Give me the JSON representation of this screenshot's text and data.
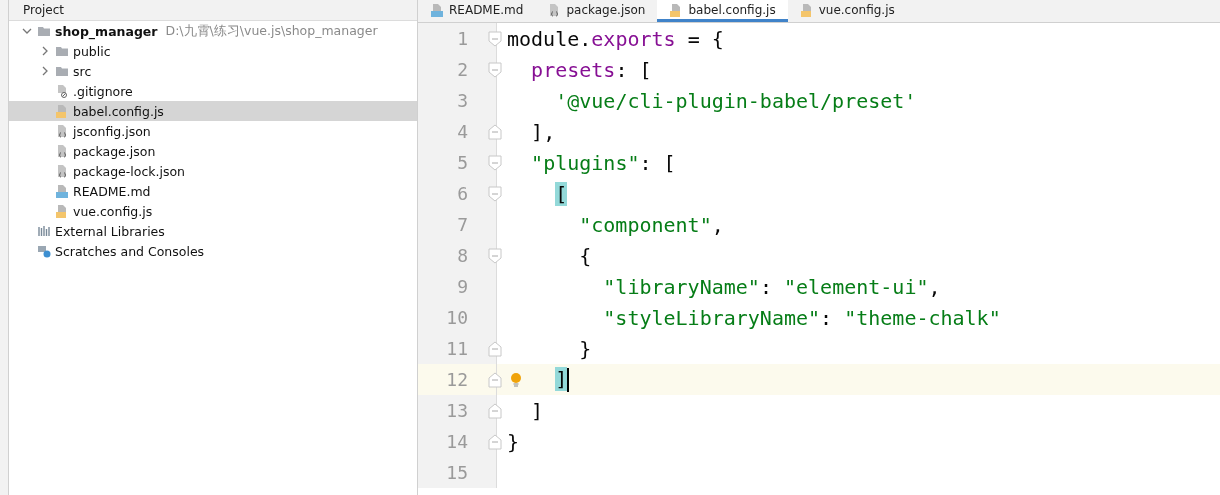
{
  "project_panel": {
    "title": "Project",
    "tree": [
      {
        "label": "shop_manager",
        "path": "D:\\九霄\\练习\\vue.js\\shop_manager",
        "kind": "folder",
        "expanded": true,
        "selected": false,
        "children": [
          {
            "label": "public",
            "kind": "folder",
            "expanded": false,
            "selected": false
          },
          {
            "label": "src",
            "kind": "folder",
            "expanded": false,
            "selected": false
          },
          {
            "label": ".gitignore",
            "kind": "ignore",
            "selected": false
          },
          {
            "label": "babel.config.js",
            "kind": "js",
            "selected": true
          },
          {
            "label": "jsconfig.json",
            "kind": "json",
            "selected": false
          },
          {
            "label": "package.json",
            "kind": "json",
            "selected": false
          },
          {
            "label": "package-lock.json",
            "kind": "json",
            "selected": false
          },
          {
            "label": "README.md",
            "kind": "md",
            "selected": false
          },
          {
            "label": "vue.config.js",
            "kind": "js",
            "selected": false
          }
        ]
      },
      {
        "label": "External Libraries",
        "kind": "libraries",
        "selected": false
      },
      {
        "label": "Scratches and Consoles",
        "kind": "scratches",
        "selected": false
      }
    ]
  },
  "editor": {
    "tabs": [
      {
        "label": "README.md",
        "kind": "md",
        "selected": false
      },
      {
        "label": "package.json",
        "kind": "json",
        "selected": false
      },
      {
        "label": "babel.config.js",
        "kind": "js",
        "selected": true
      },
      {
        "label": "vue.config.js",
        "kind": "js",
        "selected": false
      }
    ],
    "lines": [
      {
        "number": "1",
        "kind": "fold-start",
        "current": false,
        "tokens": [
          {
            "text": "module.",
            "kind": "plain"
          },
          {
            "text": "exports",
            "kind": "keyword"
          },
          {
            "text": " = {",
            "kind": "plain"
          }
        ]
      },
      {
        "number": "2",
        "kind": "fold-start",
        "current": false,
        "tokens": [
          {
            "text": "  presets",
            "kind": "keyword"
          },
          {
            "text": ": [",
            "kind": "plain"
          }
        ]
      },
      {
        "number": "3",
        "kind": "plain",
        "current": false,
        "tokens": [
          {
            "text": "    '@vue/cli-plugin-babel/preset'",
            "kind": "string"
          }
        ]
      },
      {
        "number": "4",
        "kind": "fold-end",
        "current": false,
        "tokens": [
          {
            "text": "  ],",
            "kind": "plain"
          }
        ]
      },
      {
        "number": "5",
        "kind": "fold-start",
        "current": false,
        "tokens": [
          {
            "text": "  \"plugins\"",
            "kind": "string"
          },
          {
            "text": ": [",
            "kind": "plain"
          }
        ]
      },
      {
        "number": "6",
        "kind": "fold-start",
        "current": false,
        "tokens": [
          {
            "text": "    [",
            "kind": "match"
          }
        ]
      },
      {
        "number": "7",
        "kind": "plain",
        "current": false,
        "tokens": [
          {
            "text": "      \"component\"",
            "kind": "string"
          },
          {
            "text": ",",
            "kind": "plain"
          }
        ]
      },
      {
        "number": "8",
        "kind": "fold-start",
        "current": false,
        "tokens": [
          {
            "text": "      {",
            "kind": "plain"
          }
        ]
      },
      {
        "number": "9",
        "kind": "plain",
        "current": false,
        "tokens": [
          {
            "text": "        \"libraryName\"",
            "kind": "string"
          },
          {
            "text": ": ",
            "kind": "plain"
          },
          {
            "text": "\"element-ui\"",
            "kind": "string"
          },
          {
            "text": ",",
            "kind": "plain"
          }
        ]
      },
      {
        "number": "10",
        "kind": "plain",
        "current": false,
        "tokens": [
          {
            "text": "        \"styleLibraryName\"",
            "kind": "string"
          },
          {
            "text": ": ",
            "kind": "plain"
          },
          {
            "text": "\"theme-chalk\"",
            "kind": "string"
          }
        ]
      },
      {
        "number": "11",
        "kind": "fold-end",
        "current": false,
        "tokens": [
          {
            "text": "      }",
            "kind": "plain"
          }
        ]
      },
      {
        "number": "12",
        "kind": "fold-end",
        "current": true,
        "tokens": [
          {
            "text": "    ]",
            "kind": "match"
          }
        ]
      },
      {
        "number": "13",
        "kind": "fold-end",
        "current": false,
        "tokens": [
          {
            "text": "  ]",
            "kind": "plain"
          }
        ]
      },
      {
        "number": "14",
        "kind": "fold-end",
        "current": false,
        "tokens": [
          {
            "text": "}",
            "kind": "plain"
          }
        ]
      },
      {
        "number": "15",
        "kind": "plain",
        "current": false
      }
    ]
  }
}
